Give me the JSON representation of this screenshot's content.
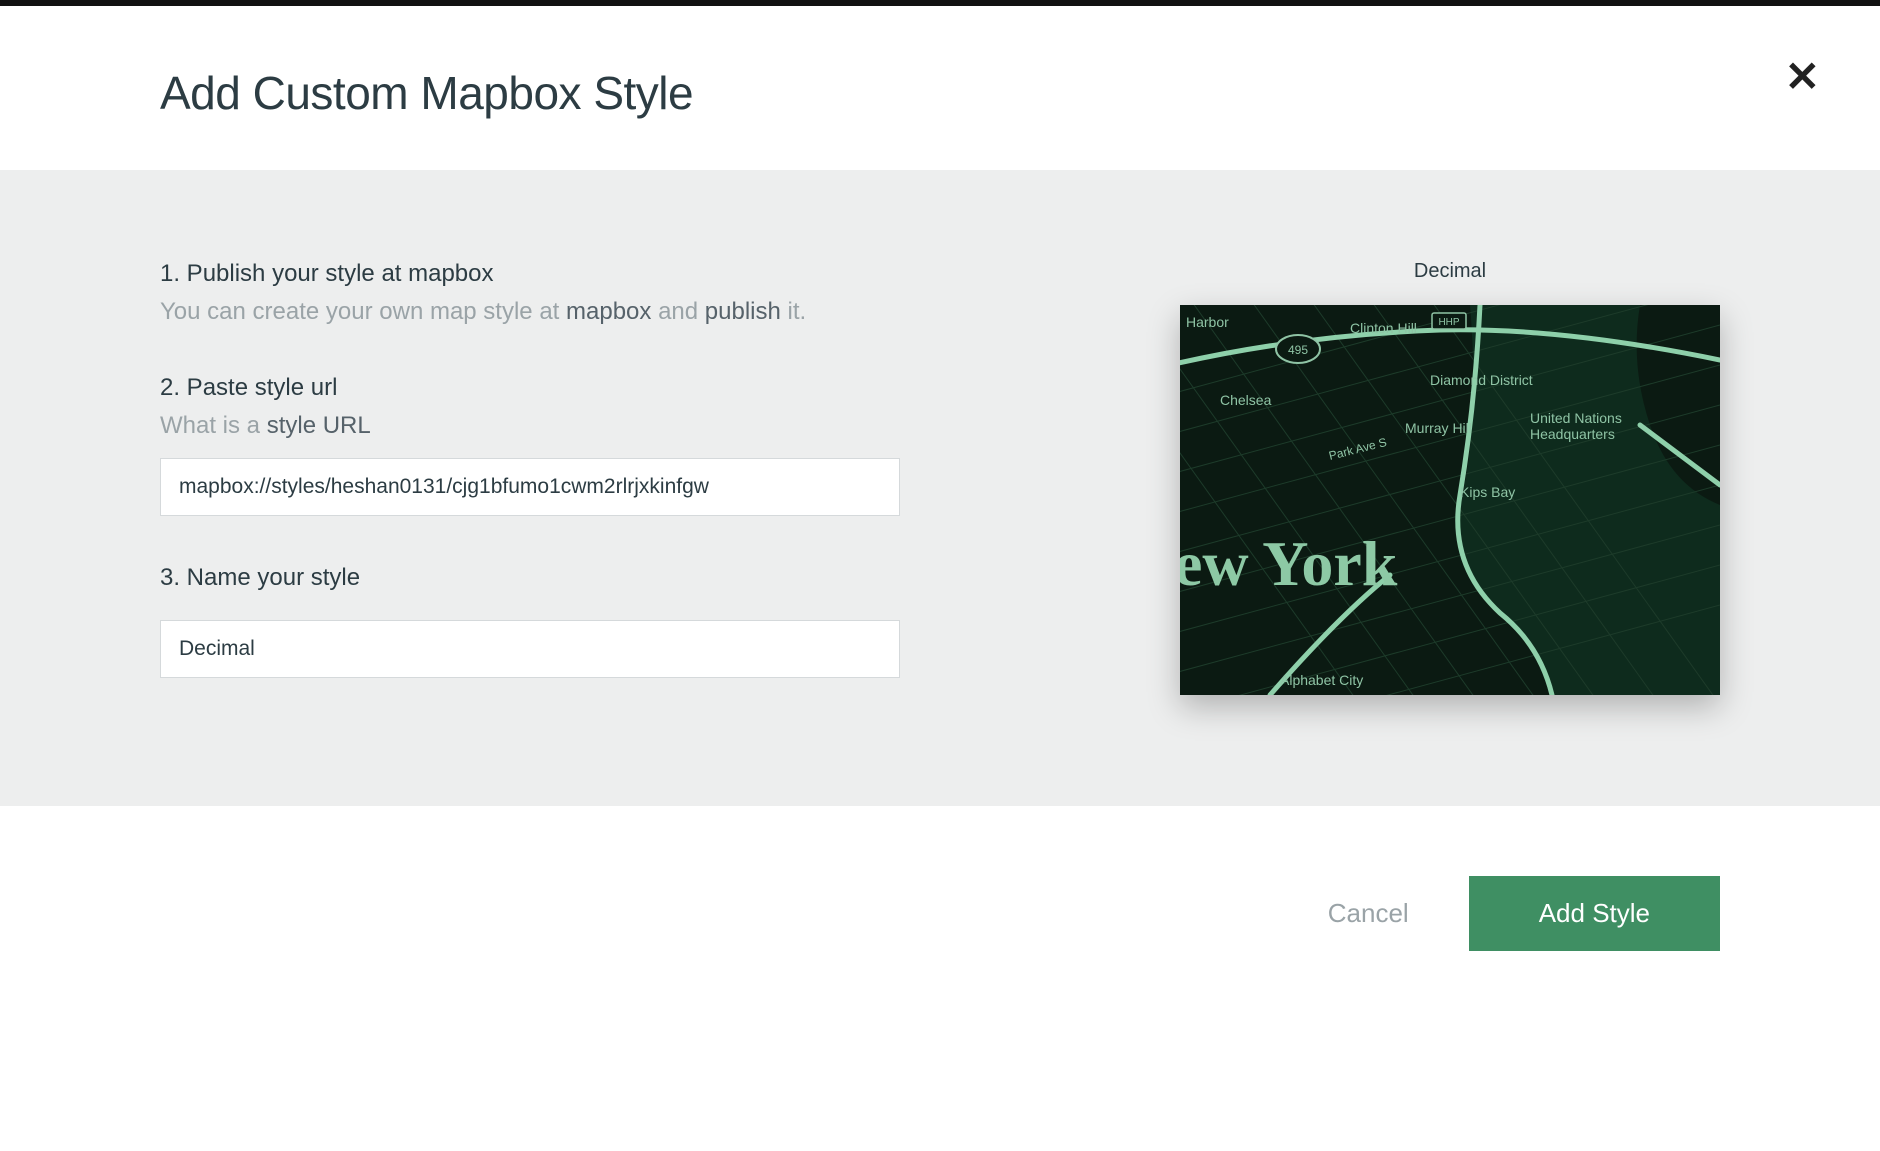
{
  "modal": {
    "title": "Add Custom Mapbox Style",
    "close_label": "✕"
  },
  "steps": {
    "step1": {
      "title": "1. Publish your style at mapbox",
      "sub_prefix": "You can create your own map style at ",
      "sub_link1": "mapbox",
      "sub_mid": " and ",
      "sub_link2": "publish",
      "sub_suffix": " it."
    },
    "step2": {
      "title": "2. Paste style url",
      "sub_prefix": "What is a ",
      "sub_link": "style URL",
      "input_value": "mapbox://styles/heshan0131/cjg1bfumo1cwm2rlrjxkinfgw"
    },
    "step3": {
      "title": "3. Name your style",
      "input_value": "Decimal"
    }
  },
  "preview": {
    "label": "Decimal",
    "map_labels": {
      "harbor": "Harbor",
      "chelsea": "Chelsea",
      "clinton_hill": "Clinton Hill",
      "diamond_district": "Diamond District",
      "murray_hill": "Murray Hill",
      "un": "United Nations\nHeadquarters",
      "kips_bay": "Kips Bay",
      "park_ave": "Park Ave S",
      "new_york": "ew York",
      "alphabet": "Alphabet City",
      "route": "495",
      "hhp": "HHP"
    }
  },
  "footer": {
    "cancel": "Cancel",
    "submit": "Add Style"
  },
  "colors": {
    "accent": "#3f8f63",
    "body_bg": "#edeeee",
    "map_bg": "#0b1a12",
    "map_line": "#98d6b2",
    "map_text": "#8fc4a5"
  }
}
